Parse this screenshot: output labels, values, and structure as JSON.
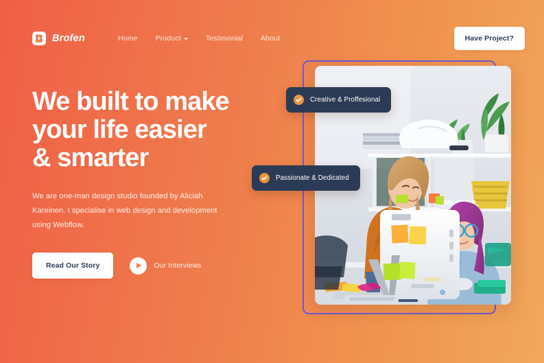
{
  "brand": {
    "name": "Brofen",
    "logo_icon": "lightning-bolt-b-icon"
  },
  "nav": {
    "links": [
      {
        "label": "Home",
        "has_caret": false
      },
      {
        "label": "Product",
        "has_caret": true
      },
      {
        "label": "Testimonial",
        "has_caret": false
      },
      {
        "label": "About",
        "has_caret": false
      }
    ],
    "cta_label": "Have Project?"
  },
  "hero": {
    "headline_lines": [
      "We built to make",
      "your life easier",
      "& smarter"
    ],
    "subcopy": "We are one-man design studio founded by Aliciah Kareinen. I specialise in web design and development using Webflow.",
    "primary_button": "Read Our Story",
    "video_label": "Our Interviews",
    "video_icon": "play-icon"
  },
  "visual": {
    "photo_alt": "Two women collaborating at a desktop computer covered in sticky notes in a bright office with shelves and plants",
    "frame_color": "#6a5ad6",
    "badges": [
      {
        "label": "Creative & Proffesional",
        "icon": "check-circle-icon"
      },
      {
        "label": "Passionate & Dedicated",
        "icon": "check-circle-icon"
      }
    ]
  },
  "colors": {
    "gradient_start": "#f05f46",
    "gradient_end": "#f0a75c",
    "badge_bg": "#2c3b55",
    "badge_check": "#e8963f",
    "frame_purple": "#6a5ad6",
    "button_text": "#2c3b55"
  }
}
